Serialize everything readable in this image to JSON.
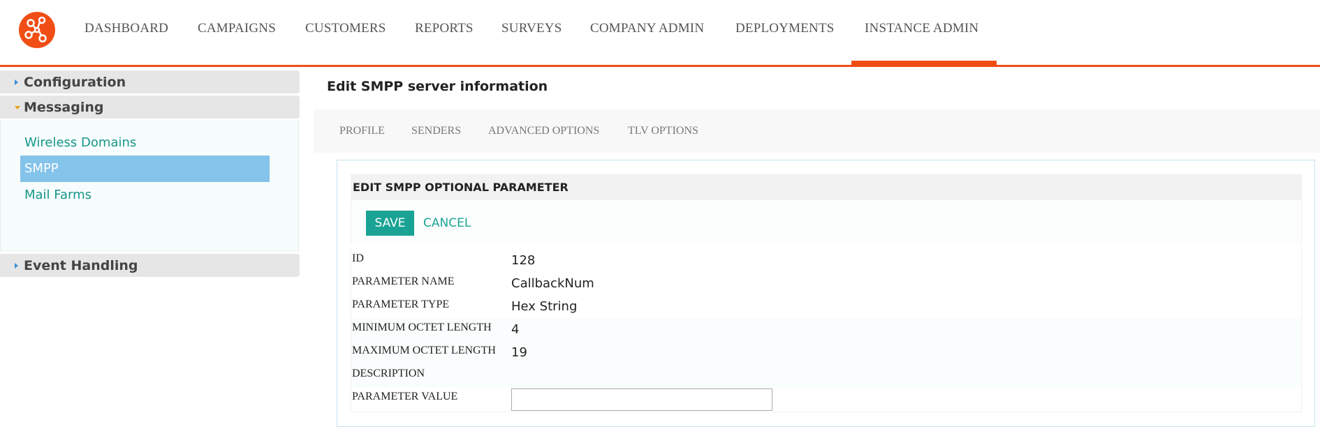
{
  "colors": {
    "brand": "#f04e14",
    "teal": "#1aa394",
    "active_nav_item": "#84c3ea"
  },
  "logo": {
    "icon": "network-nodes-icon"
  },
  "nav": {
    "items": [
      {
        "label": "DASHBOARD"
      },
      {
        "label": "CAMPAIGNS"
      },
      {
        "label": "CUSTOMERS"
      },
      {
        "label": "REPORTS"
      },
      {
        "label": "SURVEYS"
      },
      {
        "label": "COMPANY ADMIN"
      },
      {
        "label": "DEPLOYMENTS"
      },
      {
        "label": "INSTANCE ADMIN",
        "active": true
      }
    ]
  },
  "sidebar": {
    "sections": [
      {
        "label": "Configuration",
        "expanded": false
      },
      {
        "label": "Messaging",
        "expanded": true
      },
      {
        "label": "Event Handling",
        "expanded": false
      }
    ],
    "messaging_items": [
      {
        "label": "Wireless Domains"
      },
      {
        "label": "SMPP",
        "active": true
      },
      {
        "label": "Mail Farms"
      }
    ]
  },
  "main": {
    "title": "Edit SMPP server information",
    "tabs": [
      {
        "label": "PROFILE"
      },
      {
        "label": "SENDERS"
      },
      {
        "label": "ADVANCED OPTIONS"
      },
      {
        "label": "TLV OPTIONS"
      }
    ],
    "panel": {
      "title": "EDIT SMPP OPTIONAL PARAMETER",
      "save_label": "SAVE",
      "cancel_label": "CANCEL",
      "fields": [
        {
          "label": "ID",
          "value": "128"
        },
        {
          "label": "PARAMETER NAME",
          "value": "CallbackNum"
        },
        {
          "label": "PARAMETER TYPE",
          "value": "Hex String"
        },
        {
          "label": "MINIMUM OCTET LENGTH",
          "value": "4"
        },
        {
          "label": "MAXIMUM OCTET LENGTH",
          "value": "19"
        },
        {
          "label": "DESCRIPTION",
          "value": ""
        }
      ],
      "parameter_value": {
        "label": "PARAMETER VALUE",
        "value": ""
      }
    }
  }
}
